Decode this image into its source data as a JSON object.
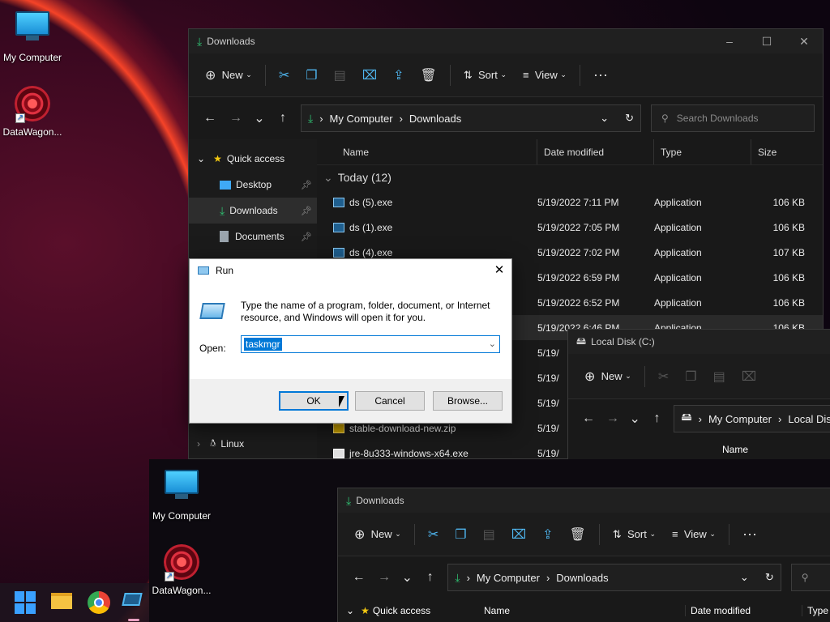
{
  "desktop": {
    "icons": [
      {
        "label": "My Computer"
      },
      {
        "label": "DataWagon..."
      },
      {
        "label": "My Computer"
      },
      {
        "label": "DataWagon..."
      }
    ]
  },
  "explorer_main": {
    "title": "Downloads",
    "toolbar": {
      "new_label": "New",
      "sort_label": "Sort",
      "view_label": "View"
    },
    "breadcrumb": [
      "My Computer",
      "Downloads"
    ],
    "search_placeholder": "Search Downloads",
    "sidebar": [
      {
        "label": "Quick access"
      },
      {
        "label": "Desktop"
      },
      {
        "label": "Downloads"
      },
      {
        "label": "Documents"
      },
      {
        "label": "Linux"
      }
    ],
    "columns": [
      "Name",
      "Date modified",
      "Type",
      "Size"
    ],
    "group_label": "Today (12)",
    "files": [
      {
        "name": "ds (5).exe",
        "date": "5/19/2022 7:11 PM",
        "type": "Application",
        "size": "106 KB"
      },
      {
        "name": "ds (1).exe",
        "date": "5/19/2022 7:05 PM",
        "type": "Application",
        "size": "106 KB"
      },
      {
        "name": "ds (4).exe",
        "date": "5/19/2022 7:02 PM",
        "type": "Application",
        "size": "107 KB"
      },
      {
        "name": "",
        "date": "5/19/2022 6:59 PM",
        "type": "Application",
        "size": "106 KB"
      },
      {
        "name": "",
        "date": "5/19/2022 6:52 PM",
        "type": "Application",
        "size": "106 KB"
      },
      {
        "name": "",
        "date": "5/19/2022 6:46 PM",
        "type": "Application",
        "size": "106 KB"
      },
      {
        "name": "",
        "date": "5/19/",
        "type": "",
        "size": ""
      },
      {
        "name": "",
        "date": "5/19/",
        "type": "",
        "size": ""
      },
      {
        "name": "",
        "date": "5/19/",
        "type": "",
        "size": ""
      },
      {
        "name": "stable-download-new.zip",
        "date": "5/19/",
        "type": "",
        "size": ""
      },
      {
        "name": "jre-8u333-windows-x64.exe",
        "date": "5/19/",
        "type": "",
        "size": ""
      }
    ]
  },
  "explorer_disk": {
    "title": "Local Disk (C:)",
    "toolbar": {
      "new_label": "New"
    },
    "breadcrumb": [
      "My Computer",
      "Local Dis"
    ],
    "column_name": "Name"
  },
  "explorer_bottom": {
    "title": "Downloads",
    "toolbar": {
      "new_label": "New",
      "sort_label": "Sort",
      "view_label": "View"
    },
    "breadcrumb": [
      "My Computer",
      "Downloads"
    ],
    "sidebar_first": "Quick access",
    "columns": [
      "Name",
      "Date modified",
      "Type"
    ]
  },
  "run_dialog": {
    "title": "Run",
    "description": "Type the name of a program, folder, document, or Internet resource, and Windows will open it for you.",
    "open_label": "Open:",
    "input_value": "taskmgr",
    "ok_label": "OK",
    "cancel_label": "Cancel",
    "browse_label": "Browse..."
  },
  "taskbar": {
    "apps": [
      "start-icon",
      "file-explorer-icon",
      "chrome-icon",
      "run-icon"
    ]
  }
}
